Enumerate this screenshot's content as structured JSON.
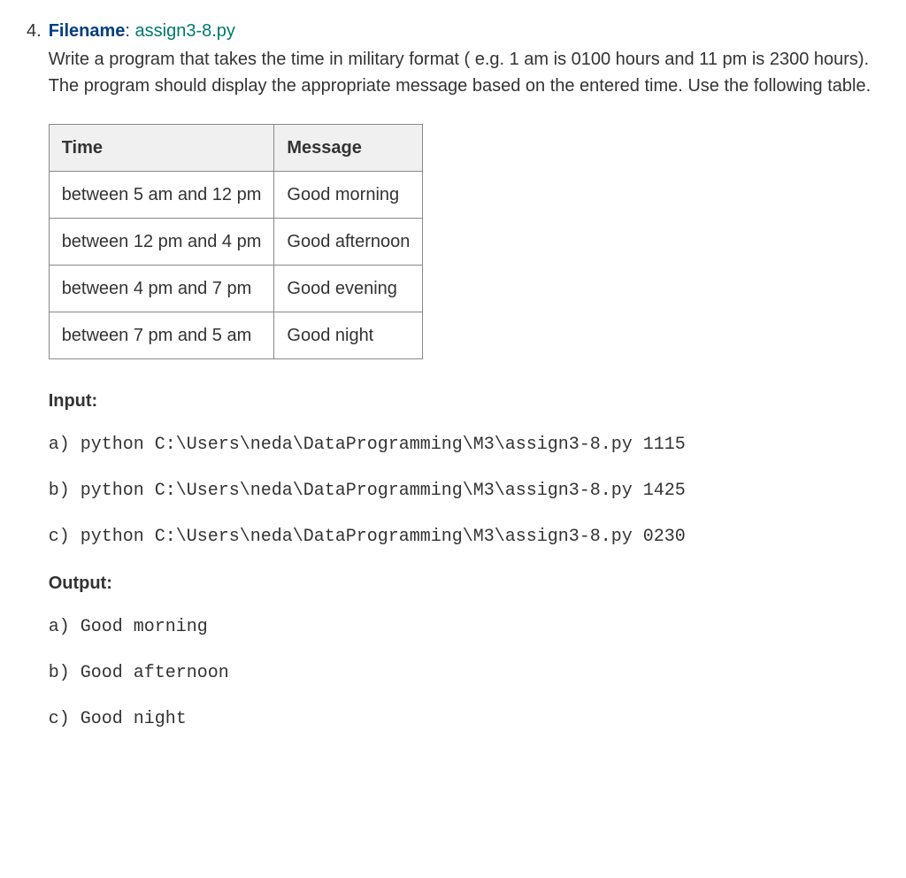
{
  "problem": {
    "number": "4.",
    "filename_label": "Filename",
    "filename_value": "assign3-8.py",
    "description": "Write a program that takes the time in military format ( e.g. 1 am is 0100 hours and 11 pm is 2300 hours). The program should display the appropriate message based on the entered time. Use the following table."
  },
  "table": {
    "headers": [
      "Time",
      "Message"
    ],
    "rows": [
      [
        "between 5 am and 12 pm",
        "Good morning"
      ],
      [
        "between 12 pm and 4 pm",
        "Good afternoon"
      ],
      [
        "between 4 pm and 7 pm",
        "Good evening"
      ],
      [
        "between 7 pm and 5 am",
        "Good night"
      ]
    ]
  },
  "input": {
    "heading": "Input:",
    "lines": [
      "a) python C:\\Users\\neda\\DataProgramming\\M3\\assign3-8.py 1115",
      "b) python C:\\Users\\neda\\DataProgramming\\M3\\assign3-8.py 1425",
      "c) python C:\\Users\\neda\\DataProgramming\\M3\\assign3-8.py 0230"
    ]
  },
  "output": {
    "heading": "Output:",
    "lines": [
      "a) Good morning",
      "b) Good afternoon",
      "c) Good night"
    ]
  }
}
